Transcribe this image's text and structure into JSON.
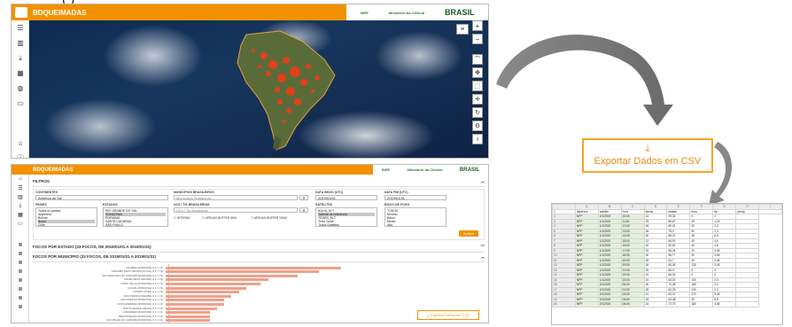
{
  "top_text": "( )",
  "app": {
    "title": "BDQUEIMADAS",
    "partner_logos": [
      "INPE",
      "Ministério da Ciência",
      "BRASIL"
    ]
  },
  "map_sidebar_icons": [
    "layers-icon",
    "chart-icon",
    "download-icon",
    "table-icon",
    "globe-icon",
    "monitor-icon",
    "home-icon",
    "info-icon"
  ],
  "data_view": {
    "title": "BDQUEIMADAS",
    "filters": {
      "title": "FILTROS",
      "continent_label": "CONTINENTES",
      "continent_value": "América do Sul",
      "municipality_label": "MUNICÍPIOS BRASILEIROS",
      "municipality_placeholder": "Municípios Brasileiros",
      "date_start_label": "DATA INÍCIO (UTC)",
      "date_start": "2019/01/01",
      "date_end_label": "DATA FIM (UTC)",
      "date_end": "2019/01/31",
      "countries_label": "PAÍSES",
      "countries": [
        "Todos os países",
        "Argentina",
        "Bolívia",
        "Brasil",
        "Chile"
      ],
      "states_label": "ESTADOS",
      "states": [
        "RIO GRANDE DO SUL",
        "RONDÔNIA",
        "RORAIMA",
        "SANTA CATARINA",
        "SÃO PAULO"
      ],
      "biomes_label": "UCS / TIS BRASILEIRAS",
      "biomes_placeholder": "UCs / Tis Brasileiras",
      "satellites_label": "SATÉLITES",
      "satellites": [
        "AQUA_M-T",
        "Satélite de referência",
        "TERRA_M-T",
        "Terra Tarde",
        "Todos Satélites"
      ],
      "risk_label": "RISCO DE FOGO",
      "risk": [
        "TODOS",
        "Mínimo",
        "Baixo",
        "Médio",
        "Alto"
      ],
      "checkboxes": [
        "INTERNO",
        "APENAS BUFFER 5KM",
        "APENAS BUFFER 10KM"
      ],
      "apply_label": "Aplicar"
    },
    "state_section_title": "FOCOS POR ESTADO (33 FOCOS, DE 2019/01/01 A 2019/01/31)",
    "municipality_section_title": "FOCOS POR MUNICÍPIO (33 FOCOS, DE 2019/01/01 A 2019/01/31)",
    "export_small_label": "Exportar Dados em CSV"
  },
  "chart_data": {
    "type": "bar",
    "orientation": "horizontal",
    "categories": [
      "CALDEIRA (RONDÔNIA) (2 F / 1 %)",
      "CORUMBÁ (MATO GROSSO DO SUL) (2 F / 1 %)",
      "SÃO FRANCISCO DO GUAPORÉ (RONDÔNIA) (2 F / 1 %)",
      "CUIABÁ (MATO GROSSO) (2 F / 1 %)",
      "PORTO VELHO (RONDÔNIA) (2 F / 1 %)",
      "CACOAL (RONDÔNIA) (1 F / 1 %)",
      "CUMARU (PARÁ) (1 F / 1 %)",
      "JOÃO PESSOA (PARAÍBA) (1 F / 1 %)",
      "ALTO PARAÍSO (RONDÔNIA) (1 F / 1 %)",
      "COSTA MARQUES (RONDÔNIA) (1 F / 1 %)",
      "PORTO GRANDE (AMAPÁ) (1 F / 1 %)",
      "ARIQUEMES (RONDÔNIA) (1 F / 1 %)",
      "PIMENTA BUENO (RONDÔNIA) (1 F / 1 %)",
      "SÃO MIGUEL DO GUAPORÉ (RONDÔNIA) (1 F / 1 %)"
    ],
    "values": [
      2.4,
      2.1,
      1.8,
      1.4,
      1.3,
      1.1,
      1.0,
      0.9,
      0.8,
      0.8,
      0.7,
      0.6,
      0.6,
      0.6
    ],
    "xlim": [
      0,
      4
    ],
    "xticks": [
      "0",
      "1",
      "2",
      "3",
      "4"
    ],
    "bar_color": "#f0a08a"
  },
  "export_button": {
    "icon": "download-icon",
    "label": "Exportar Dados em CSV",
    "color": "#e88a10"
  },
  "spreadsheet": {
    "columns": [
      "",
      "A",
      "B",
      "C",
      "D",
      "E",
      "F",
      "G",
      "H",
      "I"
    ],
    "header_row": [
      "1",
      "datahora",
      "satelite",
      "hora",
      "bioma",
      "estado",
      "risco",
      "frp",
      "precip",
      ""
    ],
    "rows": [
      [
        "2",
        "NPP",
        "1/1/2019",
        "10:00",
        "24",
        "99,34",
        "0",
        "2",
        ""
      ],
      [
        "3",
        "NPP",
        "1/1/2019",
        "11:00",
        "25",
        "88,67",
        "20",
        "1,15",
        ""
      ],
      [
        "4",
        "NPP",
        "1/1/2019",
        "12:00",
        "26",
        "80,01",
        "20",
        "2,3",
        ""
      ],
      [
        "5",
        "NPP",
        "1/1/2019",
        "13:00",
        "28",
        "78,0",
        "50",
        "2,3",
        ""
      ],
      [
        "6",
        "NPP",
        "1/1/2019",
        "14:00",
        "30",
        "66,21",
        "40",
        "6,9",
        ""
      ],
      [
        "7",
        "NPP",
        "1/1/2019",
        "15:00",
        "31",
        "66,91",
        "40",
        "4,6",
        ""
      ],
      [
        "8",
        "NPP",
        "1/1/2019",
        "16:00",
        "32",
        "62,52",
        "40",
        "4,6",
        ""
      ],
      [
        "9",
        "NPP",
        "1/1/2019",
        "17:00",
        "33",
        "55,34",
        "20",
        "3,45",
        ""
      ],
      [
        "10",
        "NPP",
        "1/1/2019",
        "18:00",
        "30",
        "56,77",
        "30",
        "3,45",
        ""
      ],
      [
        "11",
        "NPP",
        "1/1/2019",
        "19:00",
        "28",
        "61,7",
        "30",
        "3,45",
        ""
      ],
      [
        "12",
        "NPP",
        "1/1/2019",
        "20:00",
        "26",
        "65,05",
        "130",
        "3,45",
        ""
      ],
      [
        "13",
        "NPP",
        "1/1/2019",
        "21:00",
        "25",
        "66,0",
        "0",
        "0",
        ""
      ],
      [
        "14",
        "NPP",
        "1/1/2019",
        "22:00",
        "24",
        "66,34",
        "0",
        "0",
        ""
      ],
      [
        "15",
        "NPP",
        "1/1/2019",
        "23:00",
        "24",
        "63,02",
        "100",
        "2,3",
        ""
      ],
      [
        "16",
        "NPP",
        "2/1/2019",
        "00:00",
        "26",
        "70,28",
        "180",
        "2,3",
        ""
      ],
      [
        "17",
        "NPP",
        "2/1/2019",
        "01:00",
        "28",
        "62,25",
        "240",
        "2,3",
        ""
      ],
      [
        "18",
        "NPP",
        "2/1/2019",
        "02:00",
        "31",
        "62,47",
        "270",
        "3,45",
        ""
      ],
      [
        "19",
        "NPP",
        "2/1/2019",
        "03:00",
        "33",
        "63,48",
        "30",
        "6,9",
        ""
      ],
      [
        "20",
        "NPP",
        "2/1/2019",
        "04:00",
        "34",
        "72,75",
        "180",
        "3,45",
        ""
      ]
    ]
  }
}
